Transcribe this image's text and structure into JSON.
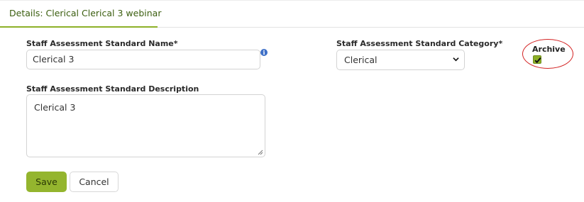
{
  "header": {
    "tab_title": "Details: Clerical Clerical 3 webinar"
  },
  "form": {
    "name_label": "Staff Assessment Standard Name*",
    "name_value": "Clerical 3",
    "info_icon": "info-icon",
    "category_label": "Staff Assessment Standard Category*",
    "category_selected": "Clerical",
    "description_label": "Staff Assessment Standard Description",
    "description_value": "Clerical 3",
    "archive_label": "Archive",
    "archive_checked": true
  },
  "buttons": {
    "save_label": "Save",
    "cancel_label": "Cancel"
  },
  "colors": {
    "accent": "#8db027",
    "tab_text": "#3b5e0f",
    "highlight_circle": "#d32222"
  }
}
